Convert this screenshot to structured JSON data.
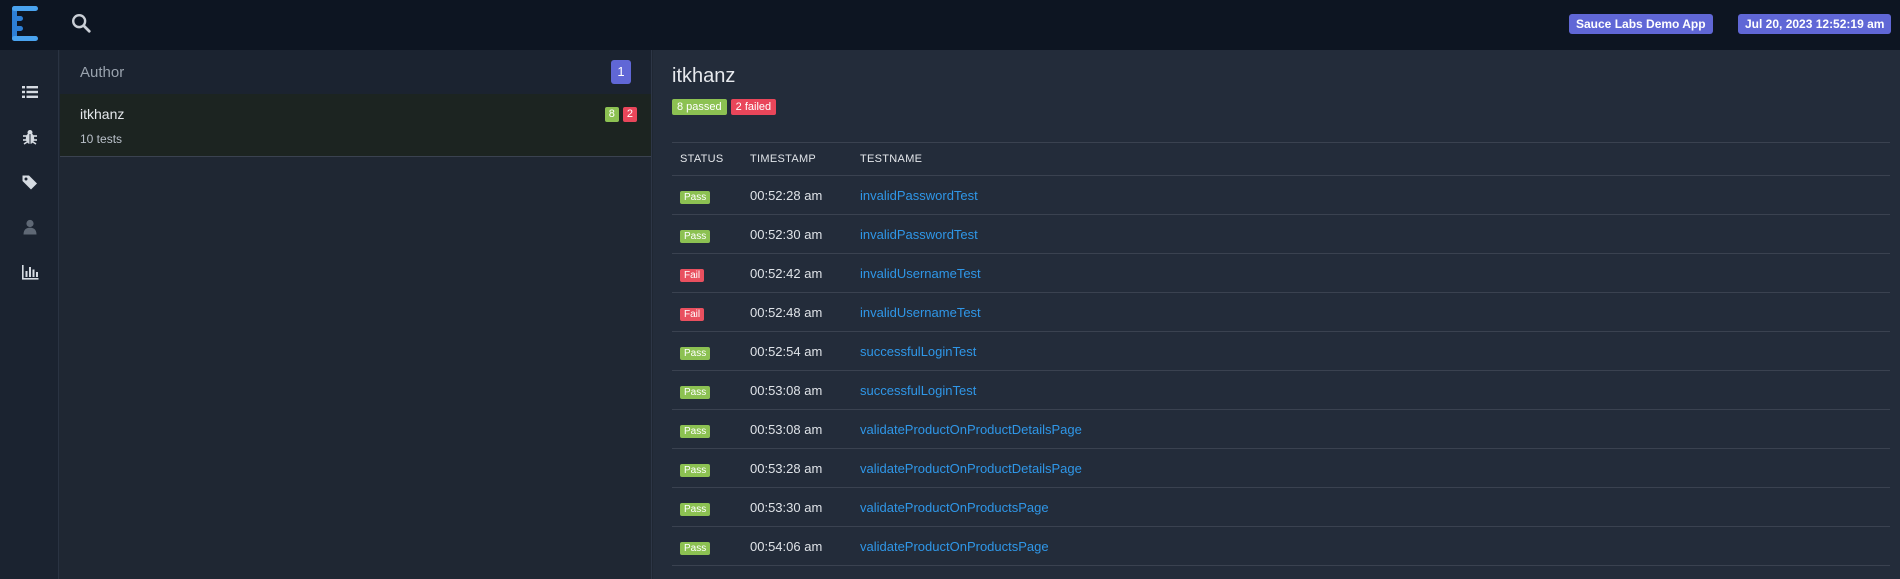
{
  "header": {
    "logo_icon": "extent-logo-icon",
    "search_icon": "search-icon",
    "app_badge": "Sauce Labs Demo App",
    "date_badge": "Jul 20, 2023 12:52:19 am",
    "badge_color": "#6067d6"
  },
  "nav": [
    {
      "icon": "list-icon"
    },
    {
      "icon": "bug-icon"
    },
    {
      "icon": "tag-icon"
    },
    {
      "icon": "user-icon"
    },
    {
      "icon": "bar-chart-icon"
    }
  ],
  "category": {
    "header_label": "Author",
    "count": "1",
    "items": [
      {
        "name": "itkhanz",
        "sub": "10 tests",
        "passed": "8",
        "failed": "2"
      }
    ]
  },
  "details": {
    "title": "itkhanz",
    "passed_badge": "8 passed",
    "failed_badge": "2 failed",
    "columns": [
      "STATUS",
      "TIMESTAMP",
      "TESTNAME"
    ],
    "rows": [
      {
        "status": "Pass",
        "time": "00:52:28 am",
        "name": "invalidPasswordTest"
      },
      {
        "status": "Pass",
        "time": "00:52:30 am",
        "name": "invalidPasswordTest"
      },
      {
        "status": "Fail",
        "time": "00:52:42 am",
        "name": "invalidUsernameTest"
      },
      {
        "status": "Fail",
        "time": "00:52:48 am",
        "name": "invalidUsernameTest"
      },
      {
        "status": "Pass",
        "time": "00:52:54 am",
        "name": "successfulLoginTest"
      },
      {
        "status": "Pass",
        "time": "00:53:08 am",
        "name": "successfulLoginTest"
      },
      {
        "status": "Pass",
        "time": "00:53:08 am",
        "name": "validateProductOnProductDetailsPage"
      },
      {
        "status": "Pass",
        "time": "00:53:28 am",
        "name": "validateProductOnProductDetailsPage"
      },
      {
        "status": "Pass",
        "time": "00:53:30 am",
        "name": "validateProductOnProductsPage"
      },
      {
        "status": "Pass",
        "time": "00:54:06 am",
        "name": "validateProductOnProductsPage"
      }
    ]
  },
  "colors": {
    "pass": "#8cc152",
    "fail": "#e9465a",
    "link": "#2f97e8"
  }
}
